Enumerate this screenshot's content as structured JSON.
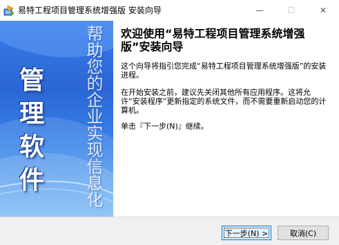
{
  "window": {
    "title": "易特工程项目管理系统增强版 安装向导",
    "minimize_glyph": "—",
    "maximize_glyph": "☐",
    "close_glyph": "✕",
    "app_icon": "installer-app-icon"
  },
  "banner": {
    "vertical_title": "管理软件",
    "tagline": "帮助您的企业实现信息化"
  },
  "content": {
    "heading": "欢迎使用“易特工程项目管理系统增强版”安装向导",
    "paragraph1": "这个向导将指引您完成“易特工程项目管理系统增强版”的安装进程。",
    "paragraph2": "在开始安装之前，建议先关闭其他所有应用程序。这将允许“安装程序”更新指定的系统文件，而不需要重新启动您的计算机。",
    "paragraph3": "单击『下一步(N)』继续。"
  },
  "buttons": {
    "next_label": "下一步(N) >",
    "cancel_label": "取消(C)"
  },
  "colors": {
    "banner_top": "#3a7ce8",
    "banner_bottom": "#6cb3f3",
    "default_button_border": "#0078d7"
  }
}
